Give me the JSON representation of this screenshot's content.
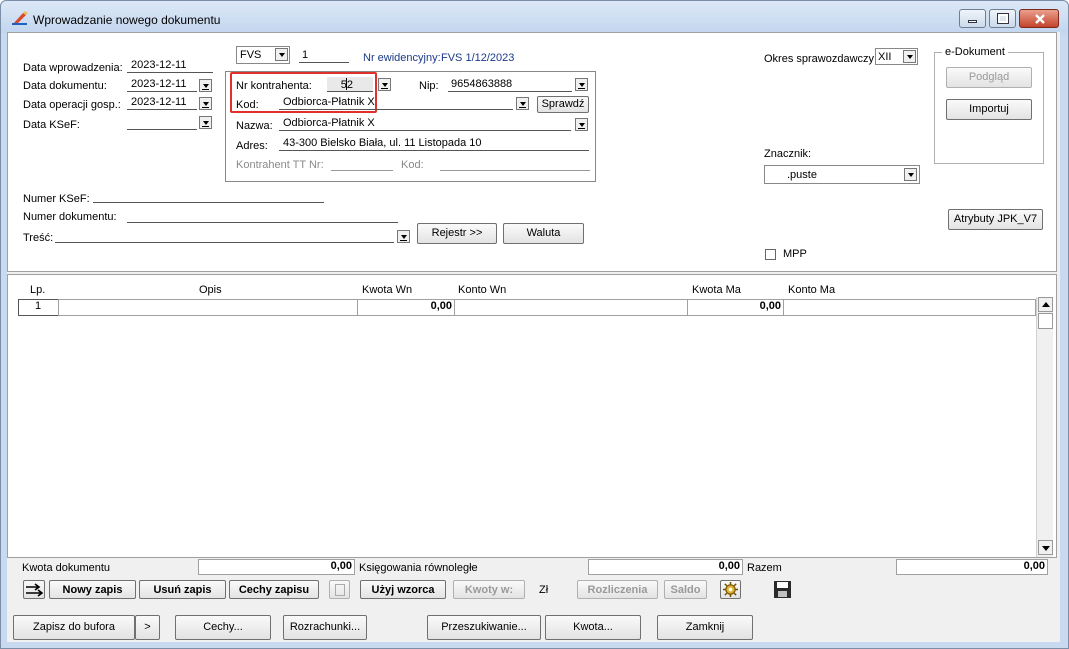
{
  "window": {
    "title": "Wprowadzanie nowego dokumentu"
  },
  "header": {
    "data_wprowadzenia_label": "Data wprowadzenia:",
    "data_wprowadzenia_value": "2023-12-11",
    "data_dokumentu_label": "Data dokumentu:",
    "data_dokumentu_value": "2023-12-11",
    "data_operacji_label": "Data operacji gosp.:",
    "data_operacji_value": "2023-12-11",
    "data_ksef_label": "Data KSeF:",
    "data_ksef_value": "",
    "doc_type": "FVS",
    "doc_number": "1",
    "nr_ewidencyjny_label": "Nr ewidencyjny:",
    "nr_ewidencyjny_value": "FVS 1/12/2023",
    "okres_label": "Okres sprawozdawczy:",
    "okres_value": "XII",
    "znacznik_label": "Znacznik:",
    "znacznik_value": ".puste",
    "mpp_label": "MPP"
  },
  "contractor": {
    "nr_label": "Nr kontrahenta:",
    "nr_value": "52",
    "nip_label": "Nip:",
    "nip_value": "9654863888",
    "kod_label": "Kod:",
    "kod_value": "Odbiorca-Płatnik X",
    "sprawdz_label": "Sprawdź",
    "nazwa_label": "Nazwa:",
    "nazwa_value": "Odbiorca-Płatnik X",
    "adres_label": "Adres:",
    "adres_value": "43-300 Bielsko Biała, ul. 11 Listopada 10",
    "tt_label": "Kontrahent TT Nr:",
    "tt_value": "",
    "tt_kod_label": "Kod:",
    "tt_kod_value": ""
  },
  "edoc": {
    "group_label": "e-Dokument",
    "podglad": "Podgląd",
    "importuj": "Importuj",
    "jpk": "Atrybuty JPK_V7"
  },
  "lower": {
    "numer_ksef_label": "Numer KSeF:",
    "numer_dok_label": "Numer dokumentu:",
    "tresc_label": "Treść:",
    "rejestr_btn": "Rejestr >>",
    "waluta_btn": "Waluta"
  },
  "grid": {
    "columns": [
      "Lp.",
      "Opis",
      "Kwota Wn",
      "Konto Wn",
      "Kwota Ma",
      "Konto Ma"
    ],
    "rows": [
      {
        "lp": "1",
        "opis": "",
        "kwota_wn": "0,00",
        "konto_wn": "",
        "kwota_ma": "0,00",
        "konto_ma": ""
      }
    ]
  },
  "summary": {
    "kwota_dokumentu_label": "Kwota dokumentu",
    "kwota_dokumentu_value": "0,00",
    "ksiegowania_label": "Księgowania równoległe",
    "ksiegowania_value": "0,00",
    "razem_label": "Razem",
    "razem_value": "0,00"
  },
  "toolbar": {
    "nowy_zapis": "Nowy zapis",
    "usun_zapis": "Usuń zapis",
    "cechy_zapisu": "Cechy zapisu",
    "uzyj_wzorca": "Użyj wzorca",
    "kwoty_w": "Kwoty w:",
    "currency": "Zł",
    "rozliczenia": "Rozliczenia",
    "saldo": "Saldo"
  },
  "bottom": {
    "zapisz": "Zapisz do bufora",
    "more": ">",
    "cechy": "Cechy...",
    "rozrachunki": "Rozrachunki...",
    "przeszukiwanie": "Przeszukiwanie...",
    "kwota": "Kwota...",
    "zamknij": "Zamknij"
  }
}
